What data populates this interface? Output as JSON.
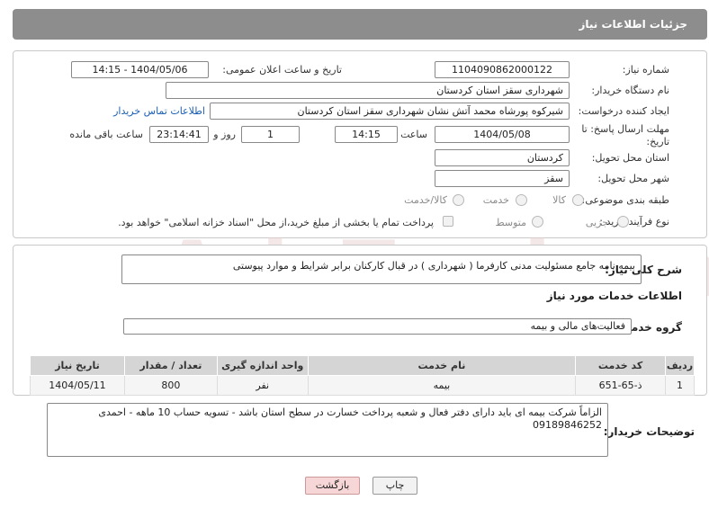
{
  "header": {
    "title": "جزئیات اطلاعات نیاز"
  },
  "watermark": "AriaTender.neT",
  "form": {
    "need_number_label": "شماره نیاز:",
    "need_number": "1104090862000122",
    "announce_label": "تاریخ و ساعت اعلان عمومی:",
    "announce_value": "1404/05/06 - 14:15",
    "buyer_org_label": "نام دستگاه خریدار:",
    "buyer_org": "شهرداری سقز استان کردستان",
    "creator_label": "ایجاد کننده درخواست:",
    "creator": "شیرکوه پورشاه محمد آتش نشان شهرداری سقز استان کردستان",
    "contact_link": "اطلاعات تماس خریدار",
    "deadline_label_1": "مهلت ارسال پاسخ: تا",
    "deadline_label_2": "تاریخ:",
    "deadline_date": "1404/05/08",
    "time_label": "ساعت",
    "deadline_time": "14:15",
    "days_value": "1",
    "days_label": "روز و",
    "remaining_time": "23:14:41",
    "remaining_label": "ساعت باقی مانده",
    "province_label": "استان محل تحویل:",
    "province": "کردستان",
    "city_label": "شهر محل تحویل:",
    "city": "سقز",
    "category_label": "طبقه بندی موضوعی:",
    "category_options": [
      "کالا",
      "خدمت",
      "کالا/خدمت"
    ],
    "process_label": "نوع فرآیند خرید :",
    "process_options": [
      "جزیی",
      "متوسط"
    ],
    "payment_note": "پرداخت تمام یا بخشی از مبلغ خرید،از محل \"اسناد خزانه اسلامی\" خواهد بود."
  },
  "description": {
    "label": "شرح کلی نیاز:",
    "text": "بیمه نامه جامع مسئولیت مدنی کارفرما ( شهرداری ) در قبال کارکنان برابر شرایط و موارد پیوستی"
  },
  "services": {
    "section_title": "اطلاعات خدمات مورد نیاز",
    "group_label": "گروه خدمت:",
    "group_value": "فعالیت‌های مالی و بیمه",
    "columns": [
      "ردیف",
      "کد خدمت",
      "نام خدمت",
      "واحد اندازه گیری",
      "تعداد / مقدار",
      "تاریخ نیاز"
    ],
    "rows": [
      {
        "index": "1",
        "code": "ذ-65-651",
        "name": "بیمه",
        "unit": "نفر",
        "qty": "800",
        "date": "1404/05/11"
      }
    ]
  },
  "buyer_notes": {
    "label": "توضیحات خریدار:",
    "text": "الزاماً شرکت بیمه ای باید دارای دفتر فعال و شعبه پرداخت خسارت در سطح استان باشد - تسویه حساب 10 ماهه - احمدی 09189846252"
  },
  "actions": {
    "print": "چاپ",
    "back": "بازگشت"
  }
}
